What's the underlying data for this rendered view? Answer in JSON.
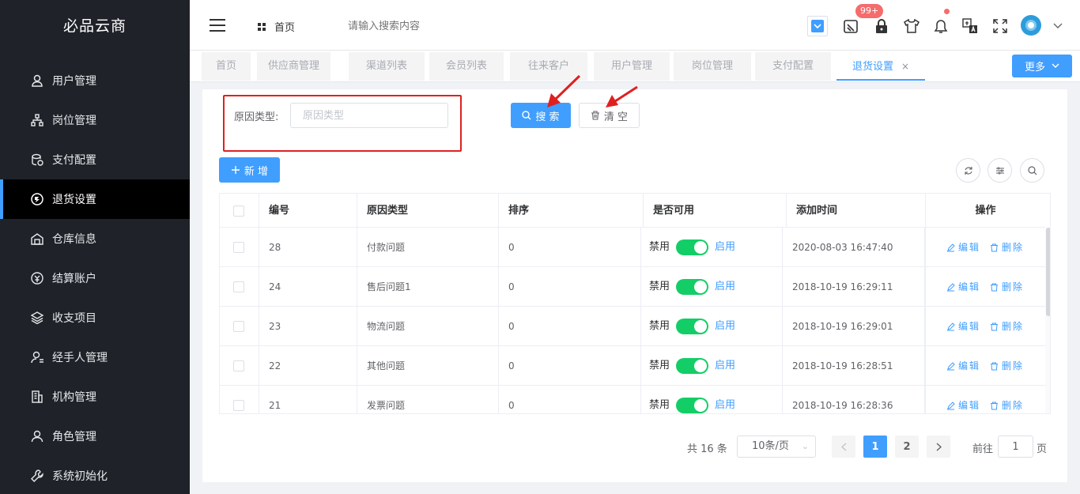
{
  "app": {
    "title": "必品云商"
  },
  "sidebar": {
    "items": [
      {
        "label": "用户管理",
        "icon": "user-icon"
      },
      {
        "label": "岗位管理",
        "icon": "org-chart-icon"
      },
      {
        "label": "支付配置",
        "icon": "coins-icon"
      },
      {
        "label": "退货设置",
        "icon": "return-icon",
        "active": true
      },
      {
        "label": "仓库信息",
        "icon": "warehouse-icon"
      },
      {
        "label": "结算账户",
        "icon": "account-icon"
      },
      {
        "label": "收支项目",
        "icon": "layers-icon"
      },
      {
        "label": "经手人管理",
        "icon": "person-icon"
      },
      {
        "label": "机构管理",
        "icon": "building-icon"
      },
      {
        "label": "角色管理",
        "icon": "role-icon"
      },
      {
        "label": "系统初始化",
        "icon": "wrench-icon"
      }
    ]
  },
  "header": {
    "breadcrumb_home": "首页",
    "search_placeholder": "请输入搜索内容",
    "badge_count": "99+"
  },
  "tabs": [
    {
      "label": "首页"
    },
    {
      "label": "供应商管理"
    },
    {
      "label": "渠道列表"
    },
    {
      "label": "会员列表"
    },
    {
      "label": "往来客户"
    },
    {
      "label": "用户管理"
    },
    {
      "label": "岗位管理"
    },
    {
      "label": "支付配置"
    },
    {
      "label": "退货设置",
      "active": true
    }
  ],
  "tab_close": "×",
  "more_label": "更多",
  "filter": {
    "label": "原因类型:",
    "placeholder": "原因类型",
    "value": "",
    "search_label": "搜 索",
    "clear_label": "清 空"
  },
  "add_label": "新 增",
  "table": {
    "columns": [
      "编号",
      "原因类型",
      "排序",
      "是否可用",
      "添加时间",
      "操作"
    ],
    "rows": [
      {
        "id": "28",
        "reason": "付款问题",
        "sort": "0",
        "off": "禁用",
        "on": "启用",
        "enabled": true,
        "time": "2020-08-03 16:47:40"
      },
      {
        "id": "24",
        "reason": "售后问题1",
        "sort": "0",
        "off": "禁用",
        "on": "启用",
        "enabled": true,
        "time": "2018-10-19 16:29:11"
      },
      {
        "id": "23",
        "reason": "物流问题",
        "sort": "0",
        "off": "禁用",
        "on": "启用",
        "enabled": true,
        "time": "2018-10-19 16:29:01"
      },
      {
        "id": "22",
        "reason": "其他问题",
        "sort": "0",
        "off": "禁用",
        "on": "启用",
        "enabled": true,
        "time": "2018-10-19 16:28:51"
      },
      {
        "id": "21",
        "reason": "发票问题",
        "sort": "0",
        "off": "禁用",
        "on": "启用",
        "enabled": true,
        "time": "2018-10-19 16:28:36"
      }
    ],
    "edit_label": "编辑",
    "delete_label": "删除"
  },
  "pagination": {
    "total": "共 16 条",
    "page_size": "10条/页",
    "pages": [
      "1",
      "2"
    ],
    "current": "1",
    "goto_prefix": "前往",
    "goto_value": "1",
    "goto_suffix": "页"
  },
  "colors": {
    "primary": "#409eff",
    "sidebar": "#1f2329",
    "switch_on": "#13ce66",
    "annotation": "#e02020"
  }
}
